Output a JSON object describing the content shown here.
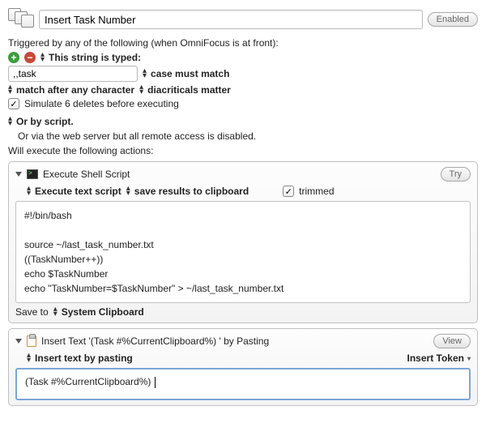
{
  "header": {
    "title": "Insert Task Number",
    "enabled_label": "Enabled"
  },
  "trigger": {
    "intro": "Triggered by any of the following (when OmniFocus is at front):",
    "typed_label": "This string is typed:",
    "typed_value": ",,task",
    "case_label": "case must match",
    "match_label": "match after any character",
    "diacriticals_label": "diacriticals matter",
    "simulate_label": "Simulate 6 deletes before executing",
    "script_label": "Or by script.",
    "web_label": "Or via the web server but all remote access is disabled."
  },
  "actions_intro": "Will execute the following actions:",
  "action1": {
    "title": "Execute Shell Script",
    "try_label": "Try",
    "opt1": "Execute text script",
    "opt2": "save results to clipboard",
    "trimmed_label": "trimmed",
    "script": "#!/bin/bash\n\nsource ~/last_task_number.txt\n((TaskNumber++))\necho $TaskNumber\necho \"TaskNumber=$TaskNumber\" > ~/last_task_number.txt",
    "save_to_label": "Save to",
    "save_to_value": "System Clipboard"
  },
  "action2": {
    "title": "Insert Text '(Task #%CurrentClipboard%) ' by Pasting",
    "view_label": "View",
    "opt1": "Insert text by pasting",
    "token_label": "Insert Token",
    "text": "(Task #%CurrentClipboard%) "
  }
}
